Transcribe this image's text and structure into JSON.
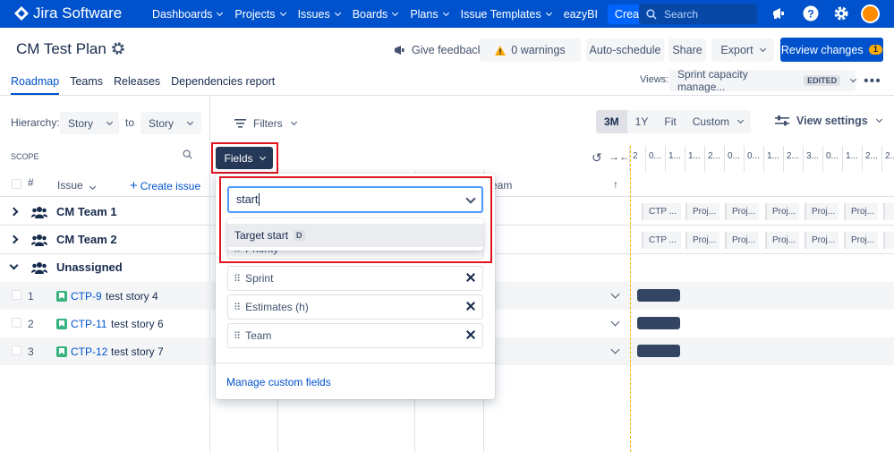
{
  "nav": {
    "logo": "Jira Software",
    "items": [
      {
        "label": "Dashboards",
        "dropdown": true
      },
      {
        "label": "Projects",
        "dropdown": true
      },
      {
        "label": "Issues",
        "dropdown": true
      },
      {
        "label": "Boards",
        "dropdown": true
      },
      {
        "label": "Plans",
        "dropdown": true
      },
      {
        "label": "Issue Templates",
        "dropdown": true
      },
      {
        "label": "eazyBI",
        "dropdown": false
      }
    ],
    "create": "Create",
    "search_placeholder": "Search",
    "colors": {
      "bar": "#0052cc",
      "create": "#0065ff"
    }
  },
  "header": {
    "title": "CM Test Plan",
    "give_feedback": "Give feedback",
    "warnings": "0 warnings",
    "auto_schedule": "Auto-schedule",
    "share": "Share",
    "export": "Export",
    "review_changes": "Review changes",
    "review_count": "1"
  },
  "tabs": [
    "Roadmap",
    "Teams",
    "Releases",
    "Dependencies report"
  ],
  "views": {
    "label": "Views:",
    "selected": "Sprint capacity manage...",
    "badge": "EDITED"
  },
  "hierarchy": {
    "label": "Hierarchy:",
    "from": "Story",
    "to_label": "to",
    "to": "Story"
  },
  "toolbar": {
    "filters": "Filters",
    "zoom": [
      "3M",
      "1Y",
      "Fit",
      "Custom"
    ],
    "zoom_selected": "3M",
    "view_settings": "View settings"
  },
  "scope": {
    "label": "SCOPE",
    "col_num": "#",
    "col_issue": "Issue",
    "create_issue": "Create issue"
  },
  "fields_button": "Fields",
  "team_column": "eam",
  "groups": [
    {
      "name": "CM Team 1",
      "expanded": false
    },
    {
      "name": "CM Team 2",
      "expanded": false
    },
    {
      "name": "Unassigned",
      "expanded": true
    }
  ],
  "issues": [
    {
      "num": "1",
      "key": "CTP-9",
      "summary": "test story 4"
    },
    {
      "num": "2",
      "key": "CTP-11",
      "summary": "test story 6"
    },
    {
      "num": "3",
      "key": "CTP-12",
      "summary": "test story 7"
    }
  ],
  "timeline": {
    "header": [
      "2",
      "0...",
      "1...",
      "1...",
      "2...",
      "0...",
      "0...",
      "1...",
      "2...",
      "3...",
      "0...",
      "1...",
      "2...",
      "2..."
    ],
    "team_row_bars": [
      "CTP ...",
      "Proj...",
      "Proj...",
      "Proj...",
      "Proj...",
      "Proj..."
    ]
  },
  "fields_dropdown": {
    "input_value": "start",
    "option": "Target start",
    "option_key": "D",
    "hidden_item": "Priority",
    "items": [
      "Sprint",
      "Estimates (h)",
      "Team"
    ],
    "manage": "Manage custom fields"
  }
}
